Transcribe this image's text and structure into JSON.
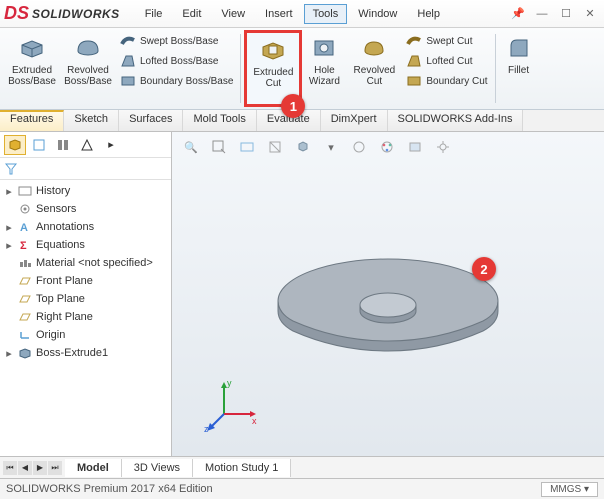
{
  "app": {
    "name": "SOLIDWORKS",
    "mark": "DS"
  },
  "menu": [
    "File",
    "Edit",
    "View",
    "Insert",
    "Tools",
    "Window",
    "Help"
  ],
  "menu_active_index": 4,
  "ribbon": {
    "extruded_boss": "Extruded\nBoss/Base",
    "revolved_boss": "Revolved\nBoss/Base",
    "swept_boss": "Swept Boss/Base",
    "lofted_boss": "Lofted Boss/Base",
    "boundary_boss": "Boundary Boss/Base",
    "extruded_cut": "Extruded\nCut",
    "hole_wizard": "Hole\nWizard",
    "revolved_cut": "Revolved\nCut",
    "swept_cut": "Swept Cut",
    "lofted_cut": "Lofted Cut",
    "boundary_cut": "Boundary Cut",
    "fillet": "Fillet"
  },
  "badges": {
    "one": "1",
    "two": "2"
  },
  "tabs": [
    "Features",
    "Sketch",
    "Surfaces",
    "Mold Tools",
    "Evaluate",
    "DimXpert",
    "SOLIDWORKS Add-Ins"
  ],
  "tabs_active_index": 0,
  "tree": {
    "history": "History",
    "sensors": "Sensors",
    "annotations": "Annotations",
    "equations": "Equations",
    "material": "Material <not specified>",
    "front": "Front Plane",
    "top": "Top Plane",
    "right": "Right Plane",
    "origin": "Origin",
    "boss_extrude1": "Boss-Extrude1"
  },
  "bottom_tabs": [
    "Model",
    "3D Views",
    "Motion Study 1"
  ],
  "bottom_active_index": 0,
  "status": {
    "left": "SOLIDWORKS Premium 2017 x64 Edition",
    "units": "MMGS"
  },
  "triad": {
    "x": "x",
    "y": "y",
    "z": "z"
  }
}
